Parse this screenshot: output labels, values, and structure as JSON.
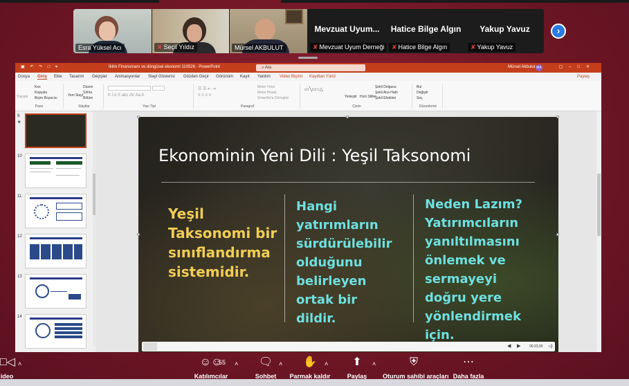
{
  "participants": [
    {
      "name": "Esra Yüksel Acı",
      "muted": false,
      "video": true
    },
    {
      "name": "Seçil Yıldız",
      "muted": true,
      "video": true
    },
    {
      "name": "Mürsel AKBULUT",
      "muted": false,
      "video": true,
      "active": true
    },
    {
      "display": "Mevzuat Uyum...",
      "name": "Mevzuat Uyum Derneği",
      "muted": true,
      "video": false
    },
    {
      "display": "Hatice Bilge Algın",
      "name": "Hatice Bilge Algın",
      "muted": true,
      "video": false
    },
    {
      "display": "Yakup Yavuz",
      "name": "Yakup Yavuz",
      "muted": true,
      "video": false
    }
  ],
  "powerpoint": {
    "window_title": "İklim Finansmanı ve döngüsel ekonomi 110526  -  PowerPoint",
    "search_placeholder": "Ara",
    "user": "Mürsel Akbulut",
    "user_initials": "MA",
    "tabs": [
      "Dosya",
      "Giriş",
      "Ekle",
      "Tasarım",
      "Geçişler",
      "Animasyonlar",
      "Slayt Gösterisi",
      "Gözden Geçir",
      "Görünüm",
      "Kayıt",
      "Yardım",
      "Video Biçimi",
      "Kayıttan Yürüt"
    ],
    "selected_tab": "Giriş",
    "share_label": "Paylaş",
    "ribbon_groups": [
      "Pano",
      "Slaytlar",
      "Yazı Tipi",
      "Paragraf",
      "Çizim",
      "Düzenleme"
    ],
    "ribbon_items": {
      "paste": "Yapıştır",
      "cut": "Kes",
      "copy": "Kopyala",
      "format_painter": "Biçim Boyacısı",
      "new_slide": "Yeni Slayt",
      "layout": "Düzen",
      "reset": "Sıfırla",
      "section": "Bölüm",
      "text_direction": "Metin Yönü",
      "align_text": "Metni Hizala",
      "smartart": "SmartArt'a Dönüştür",
      "arrange": "Yerleştir",
      "quick_styles": "Hızlı Stiller",
      "shape_fill": "Şekil Dolgusu",
      "shape_outline": "Şekil Ana Hattı",
      "shape_effects": "Şekil Efektleri",
      "find": "Bul",
      "replace": "Değiştir",
      "select": "Seç"
    },
    "thumbnails": [
      9,
      10,
      11,
      12,
      13,
      14
    ],
    "selected_thumbnail": 9
  },
  "slide": {
    "title": "Ekonominin Yeni Dili : Yeşil Taksonomi",
    "col1": [
      "Yeşil",
      "Taksonomi bir",
      "sınıflandırma",
      "sistemidir."
    ],
    "col2": [
      "Hangi",
      "yatırımların",
      "sürdürülebilir",
      "olduğunu",
      "belirleyen",
      "ortak bir",
      "dildir."
    ],
    "col3": [
      "Neden Lazım?",
      "Yatırımcıların",
      "yanıltılmasını",
      "önlemek ve",
      "sermayeyi",
      "doğru yere",
      "yönlendirmek",
      "için."
    ],
    "media_time": "00:23,00"
  },
  "toolbar": {
    "video_label": "ideo",
    "participants_label": "Katılımcılar",
    "participants_count": "55",
    "chat_label": "Sohbet",
    "raise_hand_label": "Parmak kaldır",
    "share_label": "Paylaş",
    "host_tools_label": "Oturum sahibi araçları",
    "more_label": "Daha fazla"
  }
}
